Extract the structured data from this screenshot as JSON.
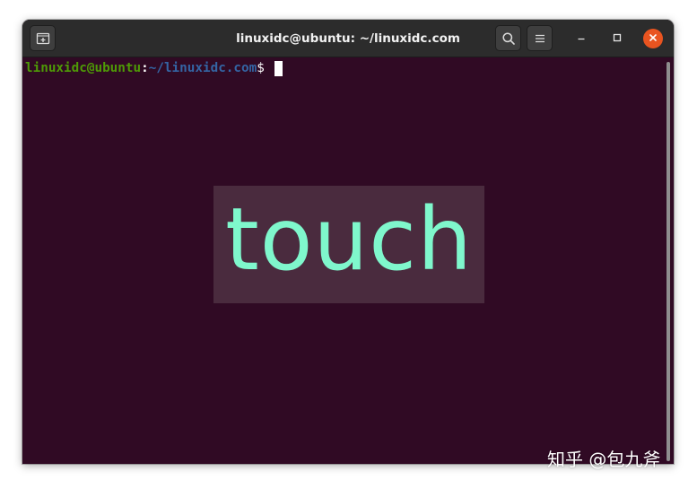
{
  "window": {
    "title": "linuxidc@ubuntu: ~/linuxidc.com"
  },
  "titlebar": {
    "new_tab_icon": "new-tab-icon",
    "search_icon": "search-icon",
    "menu_icon": "hamburger-menu-icon",
    "minimize_icon": "minimize-icon",
    "maximize_icon": "maximize-icon",
    "close_icon": "close-icon"
  },
  "terminal": {
    "prompt_user_host": "linuxidc@ubuntu",
    "prompt_colon": ":",
    "prompt_path": "~/linuxidc.com",
    "prompt_symbol": "$",
    "background_color": "#300a24",
    "user_color": "#4e9a06",
    "path_color": "#3465a4"
  },
  "overlay": {
    "word": "touch",
    "text_color": "#7ff7cc"
  },
  "watermark": {
    "text": "知乎 @包九斧"
  }
}
